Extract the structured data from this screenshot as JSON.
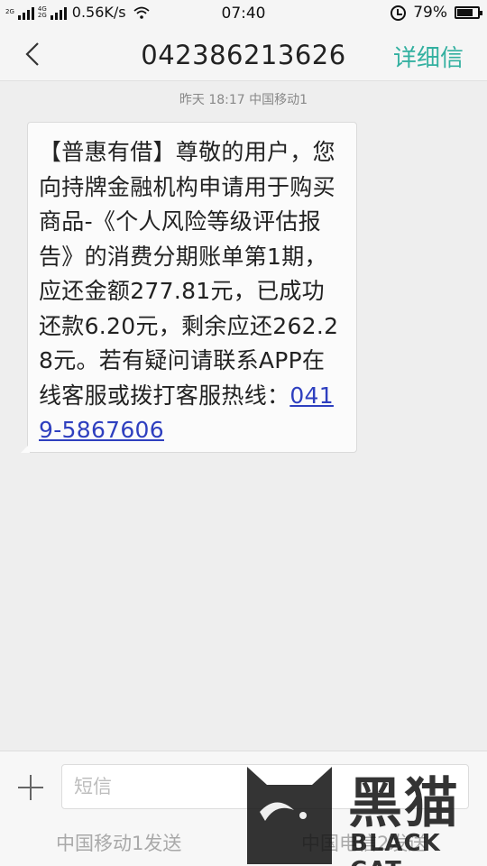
{
  "status_bar": {
    "signal1_tag": "2G",
    "signal2_tag_top": "4G",
    "signal2_tag_bottom": "2G",
    "network_speed": "0.56K/s",
    "time": "07:40",
    "battery_percent": "79%",
    "battery_level": 0.79
  },
  "header": {
    "title": "042386213626",
    "detail_label": "详细信"
  },
  "conversation": {
    "meta": "昨天  18:17  中国移动1",
    "message_text": "【普惠有借】尊敬的用户，您向持牌金融机构申请用于购买商品-《个人风险等级评估报告》的消费分期账单第1期，应还金额277.81元，已成功还款6.20元，剩余应还262.28元。若有疑问请联系APP在线客服或拨打客服热线：",
    "phone_link": "0419-5867606"
  },
  "composer": {
    "placeholder": "短信",
    "value": "",
    "send_sim1_label": "中国移动1发送",
    "send_sim2_label": "中国电信2发送"
  },
  "watermark": {
    "brand_cn": "黑猫",
    "brand_en": "BLACK CAT"
  },
  "icons": {
    "back": "chevron-left-icon",
    "add": "plus-icon",
    "alarm": "alarm-icon",
    "battery": "battery-icon",
    "wifi": "wifi-icon"
  },
  "colors": {
    "accent": "#33b0a0",
    "link": "#2e3fbf",
    "background": "#eeeeee"
  }
}
